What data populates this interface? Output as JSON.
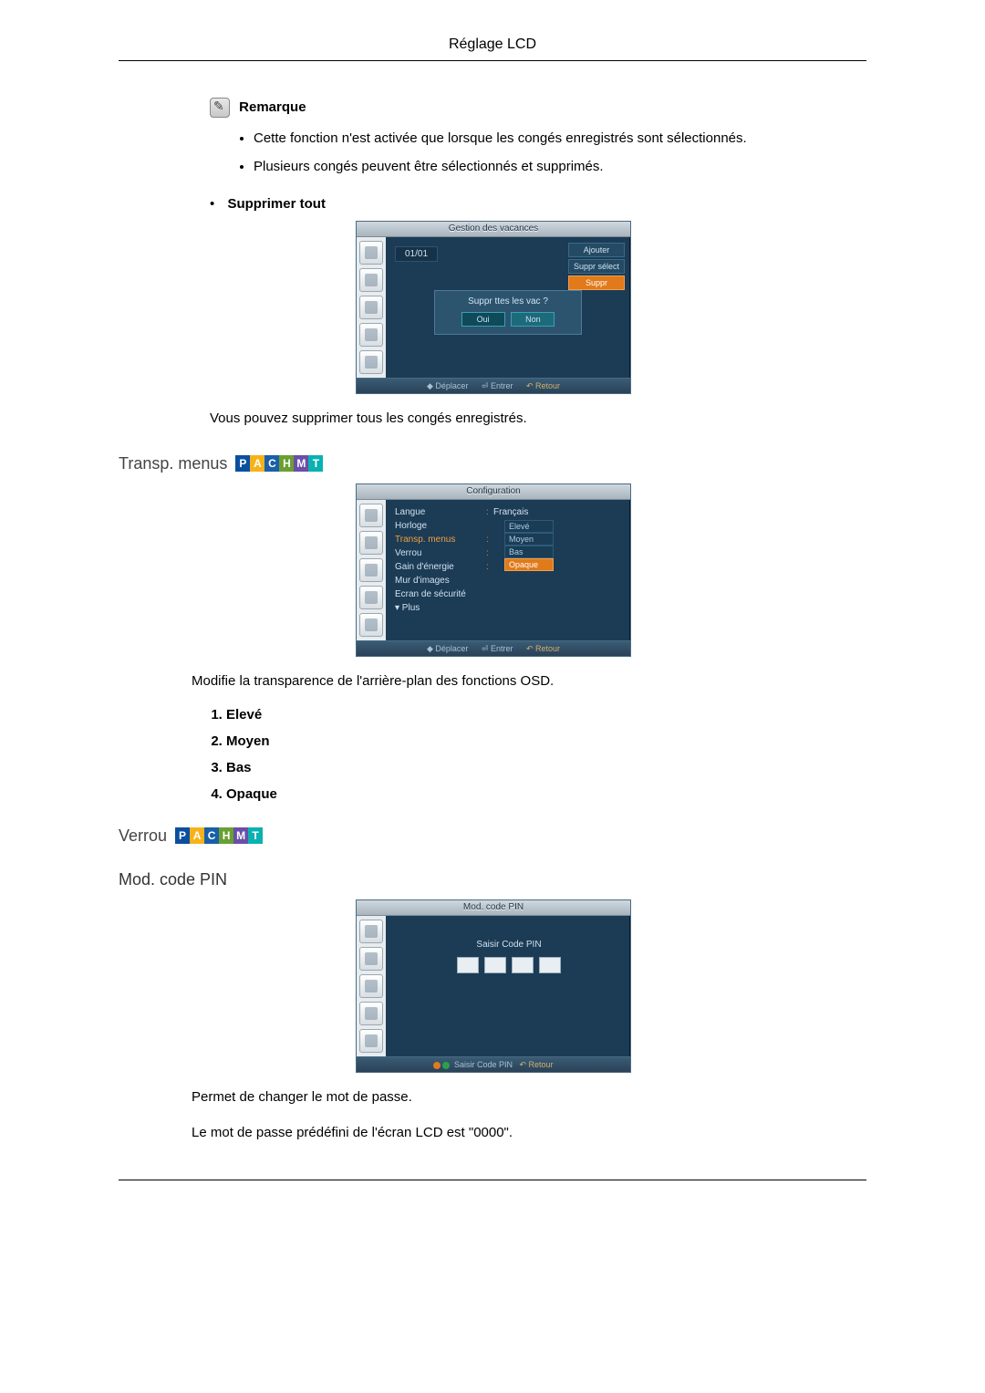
{
  "header": {
    "title": "Réglage LCD"
  },
  "remark": {
    "title": "Remarque",
    "bullets": [
      "Cette fonction n'est activée que lorsque les congés enregistrés sont sélectionnés.",
      "Plusieurs congés peuvent être sélectionnés et supprimés."
    ]
  },
  "supprimer_tout": {
    "title": "Supprimer tout",
    "after_text": "Vous pouvez supprimer tous les congés enregistrés."
  },
  "osd1": {
    "title": "Gestion des vacances",
    "date": "01/01",
    "buttons": {
      "add": "Ajouter",
      "del_sel": "Suppr sélect",
      "del_all": "Suppr"
    },
    "dialog": {
      "question": "Suppr ttes les vac ?",
      "yes": "Oui",
      "no": "Non"
    },
    "footer": {
      "move": "Déplacer",
      "enter": "Entrer",
      "return": "Retour"
    }
  },
  "transp": {
    "title": "Transp. menus",
    "description": "Modifie la transparence de l'arrière-plan des fonctions OSD.",
    "options": [
      "Elevé",
      "Moyen",
      "Bas",
      "Opaque"
    ]
  },
  "osd2": {
    "title": "Configuration",
    "rows": [
      {
        "label": "Langue",
        "value": "Français",
        "sep": ":"
      },
      {
        "label": "Horloge",
        "value": "",
        "sep": ""
      },
      {
        "label": "Transp. menus",
        "value": "",
        "sep": ":",
        "highlight": true
      },
      {
        "label": "Verrou",
        "value": "",
        "sep": ":"
      },
      {
        "label": "Gain d'énergie",
        "value": "",
        "sep": ":"
      },
      {
        "label": "Mur d'images",
        "value": "",
        "sep": ""
      },
      {
        "label": "Ecran de sécurité",
        "value": "",
        "sep": ""
      },
      {
        "label": "▾ Plus",
        "value": "",
        "sep": ""
      }
    ],
    "opts": [
      "Elevé",
      "Moyen",
      "Bas",
      "Opaque"
    ],
    "footer": {
      "move": "Déplacer",
      "enter": "Entrer",
      "return": "Retour"
    }
  },
  "verrou": {
    "title": "Verrou"
  },
  "mod_pin": {
    "title": "Mod. code PIN",
    "para1": "Permet de changer le mot de passe.",
    "para2": "Le mot de passe prédéfini de l'écran LCD est \"0000\"."
  },
  "osd3": {
    "title": "Mod. code PIN",
    "label": "Saisir Code PIN",
    "footer": {
      "hint": "Saisir Code PIN",
      "return": "Retour"
    }
  },
  "badge": [
    "P",
    "A",
    "C",
    "H",
    "M",
    "T"
  ]
}
